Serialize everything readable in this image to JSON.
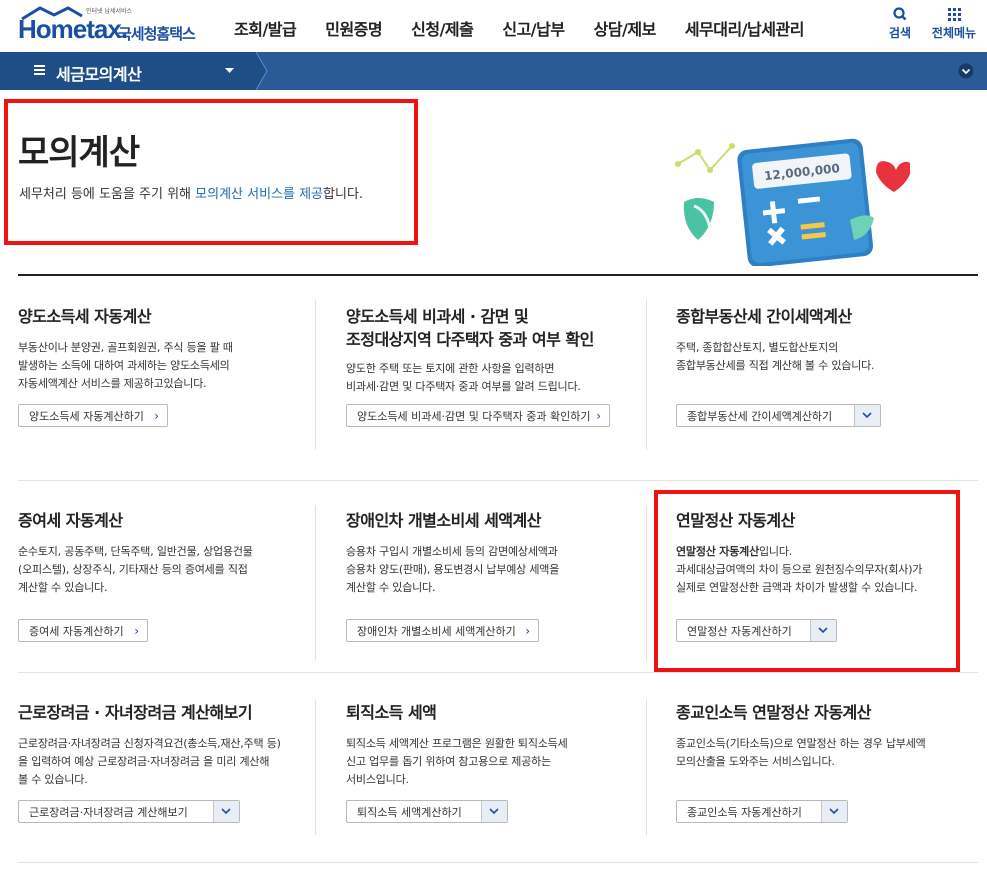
{
  "header": {
    "logo_tagline": "인터넷 납세서비스",
    "logo_name": "Hometax.",
    "logo_sub": "국세청홈택스",
    "menu": [
      "조회/발급",
      "민원증명",
      "신청/제출",
      "신고/납부",
      "상담/제보",
      "세무대리/납세관리"
    ],
    "search_label": "검색",
    "allmenu_label": "전체메뉴"
  },
  "navbar": {
    "title": "세금모의계산"
  },
  "hero": {
    "title": "모의계산",
    "desc_pre": "세무처리 등에 도움을 주기 위해 ",
    "desc_hl": "모의계산 서비스를 제공",
    "desc_post": "합니다.",
    "amount": "12,000,000"
  },
  "cards": [
    {
      "title": "양도소득세 자동계산",
      "desc": [
        "부동산이나 분양권, 골프회원권, 주식 등을 팔 때",
        "발생하는 소득에 대하여 과세하는 양도소득세의",
        "자동세액계산 서비스를 제공하고있습니다."
      ],
      "button": "양도소득세 자동계산하기"
    },
    {
      "title": "양도소득세 비과세 · 감면 및",
      "title2": "조정대상지역 다주택자 중과 여부 확인",
      "desc": [
        "양도한 주택 또는 토지에 관한 사항을 입력하면",
        "비과세·감면 및 다주택자 중과 여부를 알려 드립니다."
      ],
      "button": "양도소득세 비과세·감면 및 다주택자 중과 확인하기"
    },
    {
      "title": "종합부동산세 간이세액계산",
      "desc": [
        "주택, 종합합산토지, 별도합산토지의",
        "종합부동산세를 직접 계산해 볼 수 있습니다."
      ],
      "button": "종합부동산세 간이세액계산하기"
    },
    {
      "title": "증여세 자동계산",
      "desc": [
        "순수토지, 공동주택, 단독주택, 일반건물, 상업용건물",
        "(오피스텔), 상장주식, 기타재산 등의 증여세를 직접",
        "계산할 수 있습니다."
      ],
      "button": "증여세 자동계산하기"
    },
    {
      "title": "장애인차 개별소비세 세액계산",
      "desc": [
        "승용차 구입시 개별소비세 등의 감면예상세액과",
        "승용차 양도(판매), 용도변경시 납부예상 세액을",
        "계산할 수 있습니다."
      ],
      "button": "장애인차 개별소비세 세액계산하기"
    },
    {
      "title": "연말정산 자동계산",
      "desc_bold": "연말정산 자동계산",
      "desc_bold_post": "입니다.",
      "desc": [
        "과세대상급여액의 차이 등으로 원천징수의무자(회사)가",
        "실제로 연말정산한 금액과 차이가 발생할 수 있습니다."
      ],
      "button": "연말정산 자동계산하기"
    },
    {
      "title": "근로장려금 · 자녀장려금 계산해보기",
      "desc": [
        "근로장려금·자녀장려금 신청자격요건(총소득,재산,주택 등)",
        "을 입력하여 예상 근로장려금·자녀장려금 을 미리 계산해",
        "볼 수 있습니다."
      ],
      "button": "근로장려금·자녀장려금 계산해보기"
    },
    {
      "title": "퇴직소득 세액",
      "desc": [
        "퇴직소득 세액계산 프로그램은 원활한 퇴직소득세",
        "신고 업무를 돕기 위하여 참고용으로 제공하는",
        "서비스입니다."
      ],
      "button": "퇴직소득 세액계산하기"
    },
    {
      "title": "종교인소득 연말정산 자동계산",
      "desc": [
        "종교인소득(기타소득)으로 연말정산 하는 경우 납부세액",
        "모의산출을 도와주는 서비스입니다."
      ],
      "button": "종교인소득 자동계산하기"
    }
  ]
}
